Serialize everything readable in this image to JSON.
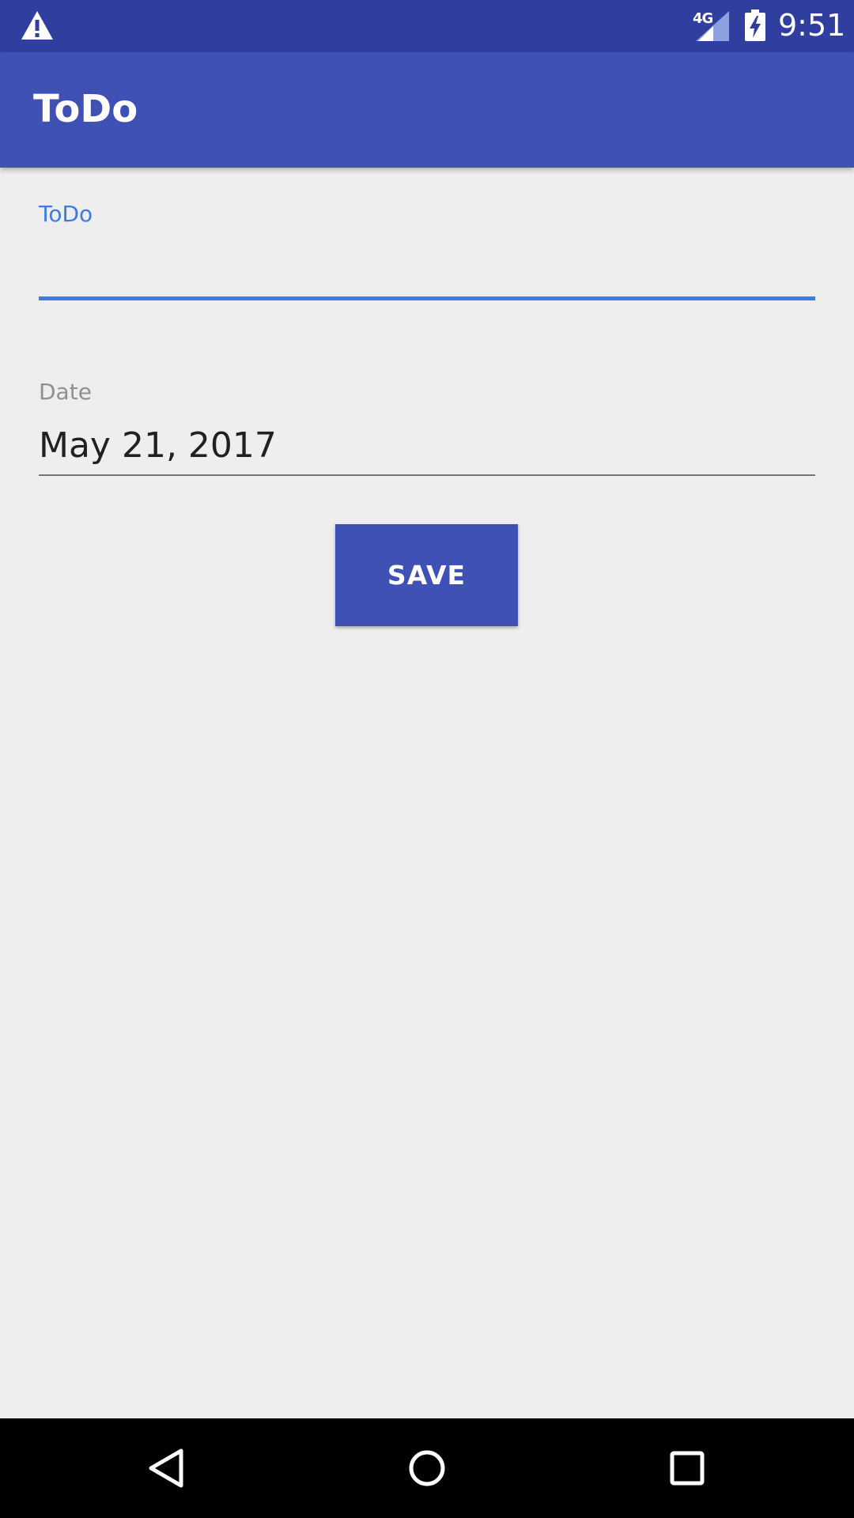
{
  "status_bar": {
    "time": "9:51",
    "network": "4G",
    "icons": [
      "warning-icon",
      "signal-icon",
      "battery-charging-icon"
    ]
  },
  "app_bar": {
    "title": "ToDo"
  },
  "form": {
    "todo_label": "ToDo",
    "todo_value": "",
    "date_label": "Date",
    "date_value": "May 21, 2017",
    "save_label": "SAVE"
  },
  "nav_bar": {
    "icons": [
      "back-icon",
      "home-icon",
      "recents-icon"
    ]
  },
  "colors": {
    "primary": "#3f51b5",
    "primary_dark": "#303f9f",
    "accent": "#3d7be0",
    "background": "#eeeeee"
  }
}
